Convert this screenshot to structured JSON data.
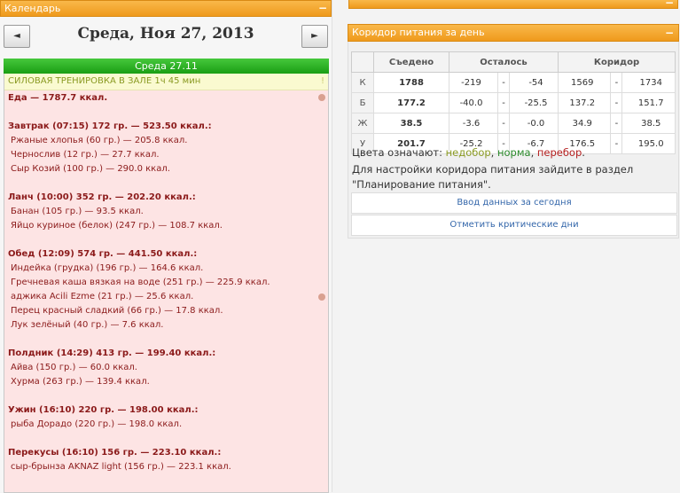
{
  "calendar": {
    "header": "Календарь",
    "minimize": "−",
    "prev_label": "◄",
    "next_label": "►",
    "date_title": "Среда, Ноя 27, 2013",
    "day_header": "Среда 27.11",
    "training": "СИЛОВАЯ ТРЕНИРОВКА В ЗАЛЕ 1ч 45 мин",
    "training_mark": "!",
    "food_total": "Еда — 1787.7 ккал.",
    "meals": [
      {
        "title": "Завтрак (07:15) 172 гр. — 523.50 ккал.:",
        "items": [
          "Ржаные хлопья (60 гр.) — 205.8 ккал.",
          "Чернослив (12 гр.) — 27.7 ккал.",
          "Сыр Козий (100 гр.) — 290.0 ккал."
        ]
      },
      {
        "title": "Ланч (10:00) 352 гр. — 202.20 ккал.:",
        "items": [
          "Банан (105 гр.) — 93.5 ккал.",
          "Яйцо куриное (белок) (247 гр.) — 108.7 ккал."
        ]
      },
      {
        "title": "Обед (12:09) 574 гр. — 441.50 ккал.:",
        "items": [
          "Индейка (грудка) (196 гр.) — 164.6 ккал.",
          "Гречневая каша вязкая на воде (251 гр.) — 225.9 ккал.",
          "аджика Acili Ezme (21 гр.) — 25.6 ккал.",
          "Перец красный сладкий (66 гр.) — 17.8 ккал.",
          "Лук зелёный (40 гр.) — 7.6 ккал."
        ]
      },
      {
        "title": "Полдник (14:29) 413 гр. — 199.40 ккал.:",
        "items": [
          "Айва (150 гр.) — 60.0 ккал.",
          "Хурма (263 гр.) — 139.4 ккал."
        ]
      },
      {
        "title": "Ужин (16:10) 220 гр. — 198.00 ккал.:",
        "items": [
          "рыба Дорадо (220 гр.) — 198.0 ккал."
        ]
      },
      {
        "title": "Перекусы (16:10) 156 гр. — 223.10 ккал.:",
        "items": [
          "сыр-брынза AKNAZ light (156 гр.) — 223.1 ккал."
        ]
      }
    ]
  },
  "corridor": {
    "header": "Коридор питания за день",
    "minimize": "−",
    "columns": [
      "Съедено",
      "Осталось",
      "Коридор"
    ],
    "dash": "-",
    "rows": [
      {
        "label": "К",
        "eaten": "1788",
        "left_min": "-219",
        "left_max": "-54",
        "corr_min": "1569",
        "corr_max": "1734"
      },
      {
        "label": "Б",
        "eaten": "177.2",
        "left_min": "-40.0",
        "left_max": "-25.5",
        "corr_min": "137.2",
        "corr_max": "151.7"
      },
      {
        "label": "Ж",
        "eaten": "38.5",
        "left_min": "-3.6",
        "left_max": "-0.0",
        "corr_min": "34.9",
        "corr_max": "38.5"
      },
      {
        "label": "У",
        "eaten": "201.7",
        "left_min": "-25.2",
        "left_max": "-6.7",
        "corr_min": "176.5",
        "corr_max": "195.0"
      }
    ],
    "legend_prefix": "Цвета означают:",
    "legend_under": "недобор",
    "legend_norm": "норма",
    "legend_over": "перебор",
    "legend_sep": ",",
    "legend_end": ".",
    "hint": "Для настройки коридора питания зайдите в раздел \"Планирование питания\".",
    "btn_enter": "Ввод данных за сегодня",
    "btn_critical": "Отметить критические дни",
    "top_panel_minimize": "−"
  },
  "colors": {
    "orange": "#ef9a1c",
    "green": "#1a9e14",
    "pink": "#fde4e4",
    "dark_red": "#8b1a1a",
    "link_blue": "#3366aa"
  }
}
